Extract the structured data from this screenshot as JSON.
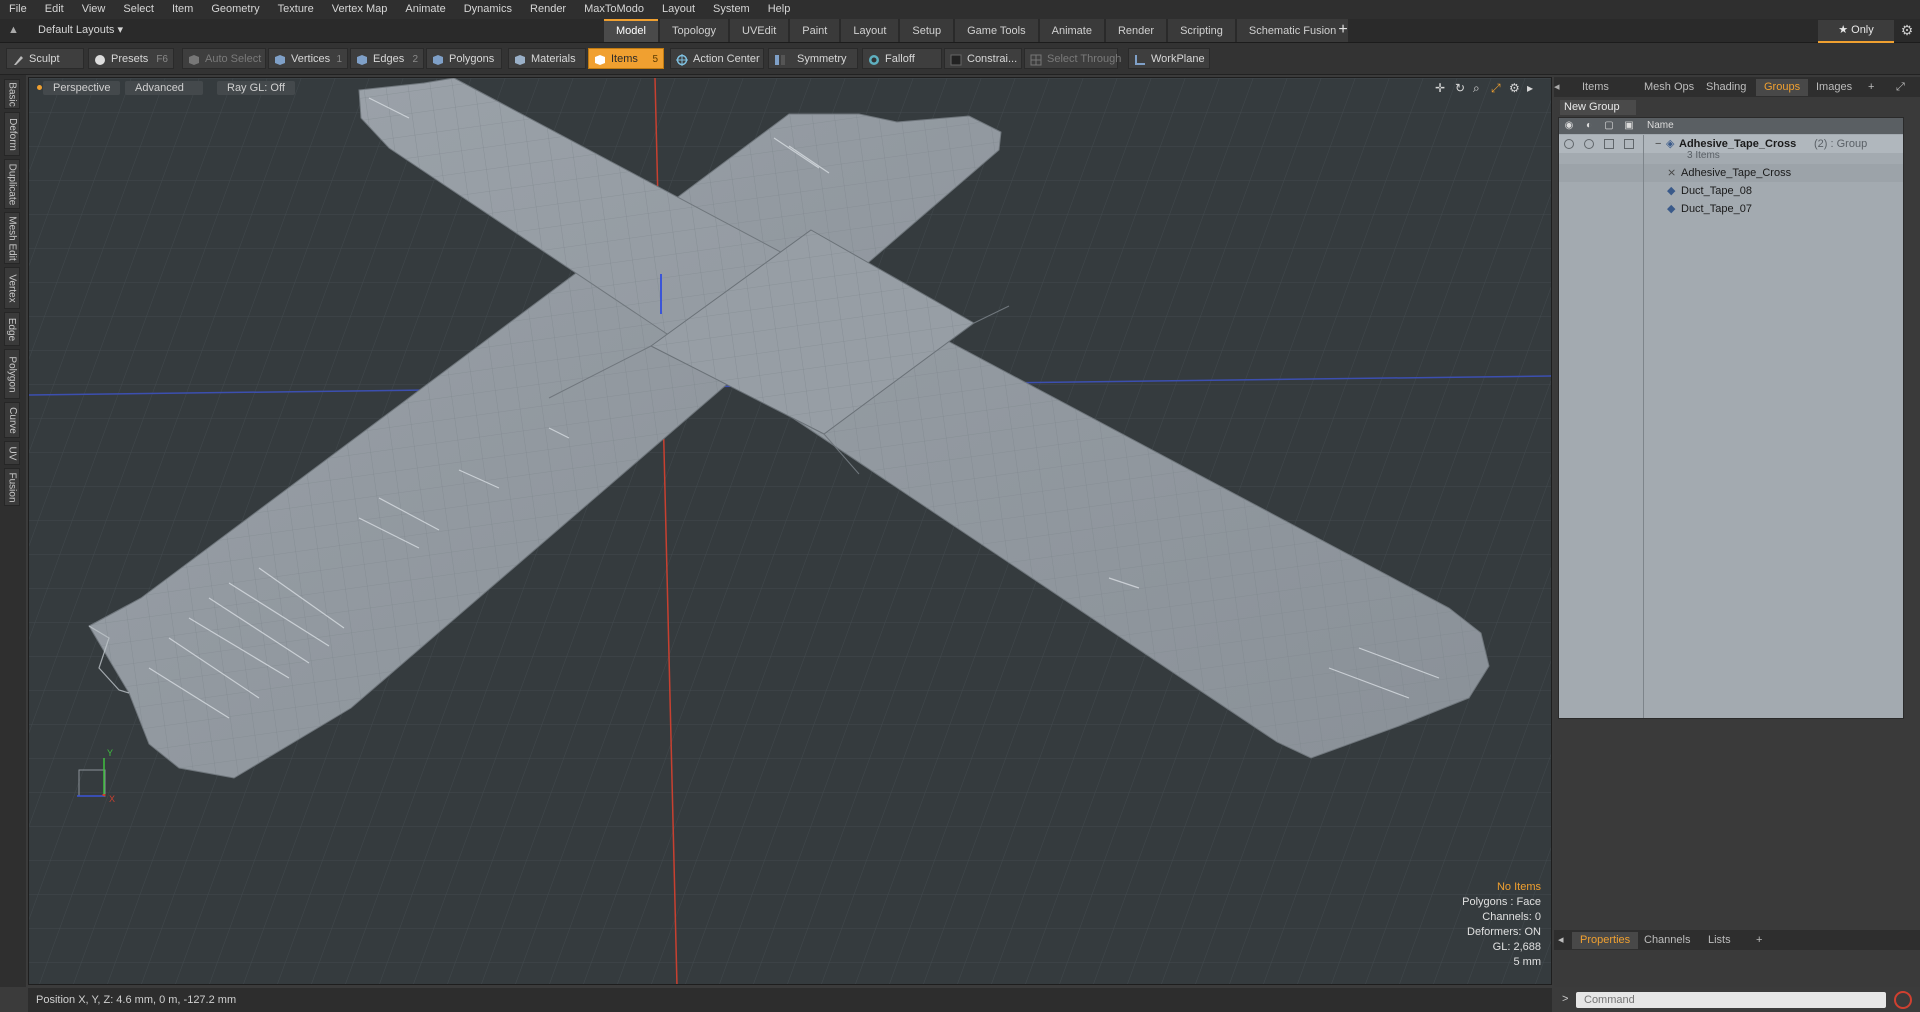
{
  "menu": [
    "File",
    "Edit",
    "View",
    "Select",
    "Item",
    "Geometry",
    "Texture",
    "Vertex Map",
    "Animate",
    "Dynamics",
    "Render",
    "MaxToModo",
    "Layout",
    "System",
    "Help"
  ],
  "layout_dropdown": "Default Layouts ▾",
  "tabs": [
    {
      "label": "Model",
      "active": true
    },
    {
      "label": "Topology",
      "active": false
    },
    {
      "label": "UVEdit",
      "active": false
    },
    {
      "label": "Paint",
      "active": false
    },
    {
      "label": "Layout",
      "active": false
    },
    {
      "label": "Setup",
      "active": false
    },
    {
      "label": "Game Tools",
      "active": false
    },
    {
      "label": "Animate",
      "active": false
    },
    {
      "label": "Render",
      "active": false
    },
    {
      "label": "Scripting",
      "active": false
    },
    {
      "label": "Schematic Fusion",
      "active": false
    }
  ],
  "tab_plus": "+",
  "only_label": "★  Only",
  "toolbar": {
    "sculpt": "Sculpt",
    "presets": "Presets",
    "presets_key": "F6",
    "auto_select": "Auto Select",
    "vertices": "Vertices",
    "vertices_key": "1",
    "edges": "Edges",
    "edges_key": "2",
    "polygons": "Polygons",
    "materials": "Materials",
    "items": "Items",
    "items_key": "5",
    "action_center": "Action Center",
    "symmetry": "Symmetry",
    "falloff": "Falloff",
    "constraints": "Constrai...",
    "select_through": "Select Through",
    "workplane": "WorkPlane"
  },
  "left_tabs": [
    "Basic",
    "Deform",
    "Duplicate",
    "Mesh Edit",
    "Vertex",
    "Edge",
    "Polygon",
    "Curve",
    "UV",
    "Fusion"
  ],
  "viewport": {
    "perspective": "Perspective",
    "advanced": "Advanced",
    "raygl": "Ray GL: Off",
    "info": {
      "no_items": "No Items",
      "polygons": "Polygons : Face",
      "channels": "Channels: 0",
      "deformers": "Deformers: ON",
      "gl": "GL: 2,688",
      "scale": "5 mm"
    }
  },
  "right_tabs": [
    {
      "label": "Items",
      "active": false
    },
    {
      "label": "Mesh Ops",
      "active": false
    },
    {
      "label": "Shading",
      "active": false
    },
    {
      "label": "Groups",
      "active": true
    },
    {
      "label": "Images",
      "active": false
    }
  ],
  "right_plus": "+",
  "new_group": "New Group",
  "tree": {
    "name_header": "Name",
    "group_name": "Adhesive_Tape_Cross",
    "group_suffix": " (2) : Group",
    "group_count": "3 Items",
    "items": [
      "Adhesive_Tape_Cross",
      "Duct_Tape_08",
      "Duct_Tape_07"
    ]
  },
  "prop_tabs": [
    {
      "label": "Properties",
      "active": true
    },
    {
      "label": "Channels",
      "active": false
    },
    {
      "label": "Lists",
      "active": false
    }
  ],
  "prop_plus": "+",
  "status": "Position X, Y, Z:   4.6 mm, 0 m, -127.2 mm",
  "command_placeholder": "Command",
  "command_arrow": ">",
  "axis": {
    "y": "Y",
    "x": "X"
  },
  "colors": {
    "accent": "#f0a030",
    "x_axis": "#c84030",
    "z_axis": "#3c4fb0"
  }
}
